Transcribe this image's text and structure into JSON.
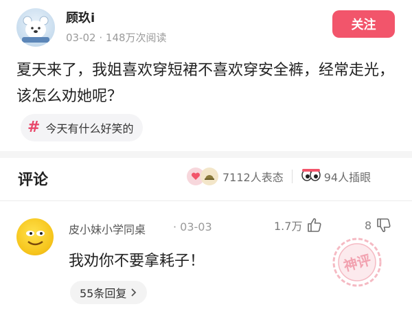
{
  "post": {
    "author": "顾玖i",
    "date": "03-02",
    "views": "148万次阅读",
    "follow_label": "关注",
    "text": "夏天来了，我姐喜欢穿短裙不喜欢穿安全裤，经常走光，该怎么劝她呢？",
    "topic": "今天有什么好笑的"
  },
  "comments_header": {
    "title": "评论",
    "reaction_count": "7112人表态",
    "insert_count": "94人插眼"
  },
  "comment": {
    "author": "皮小妹小学同桌",
    "date": "03-03",
    "likes": "1.7万",
    "dislikes": "8",
    "text": "我劝你不要拿耗子！",
    "reply_label": "55条回复"
  },
  "watermark_text": "神评",
  "colors": {
    "accent": "#f2556b",
    "hash": "#e8486a",
    "watermark": "#f2a3b0"
  },
  "icons": [
    "bear-avatar",
    "smiley-avatar",
    "thumbs-up-icon",
    "thumbs-down-icon",
    "hash-icon",
    "chevron-right-icon",
    "eyes-icon",
    "reaction-icons"
  ]
}
